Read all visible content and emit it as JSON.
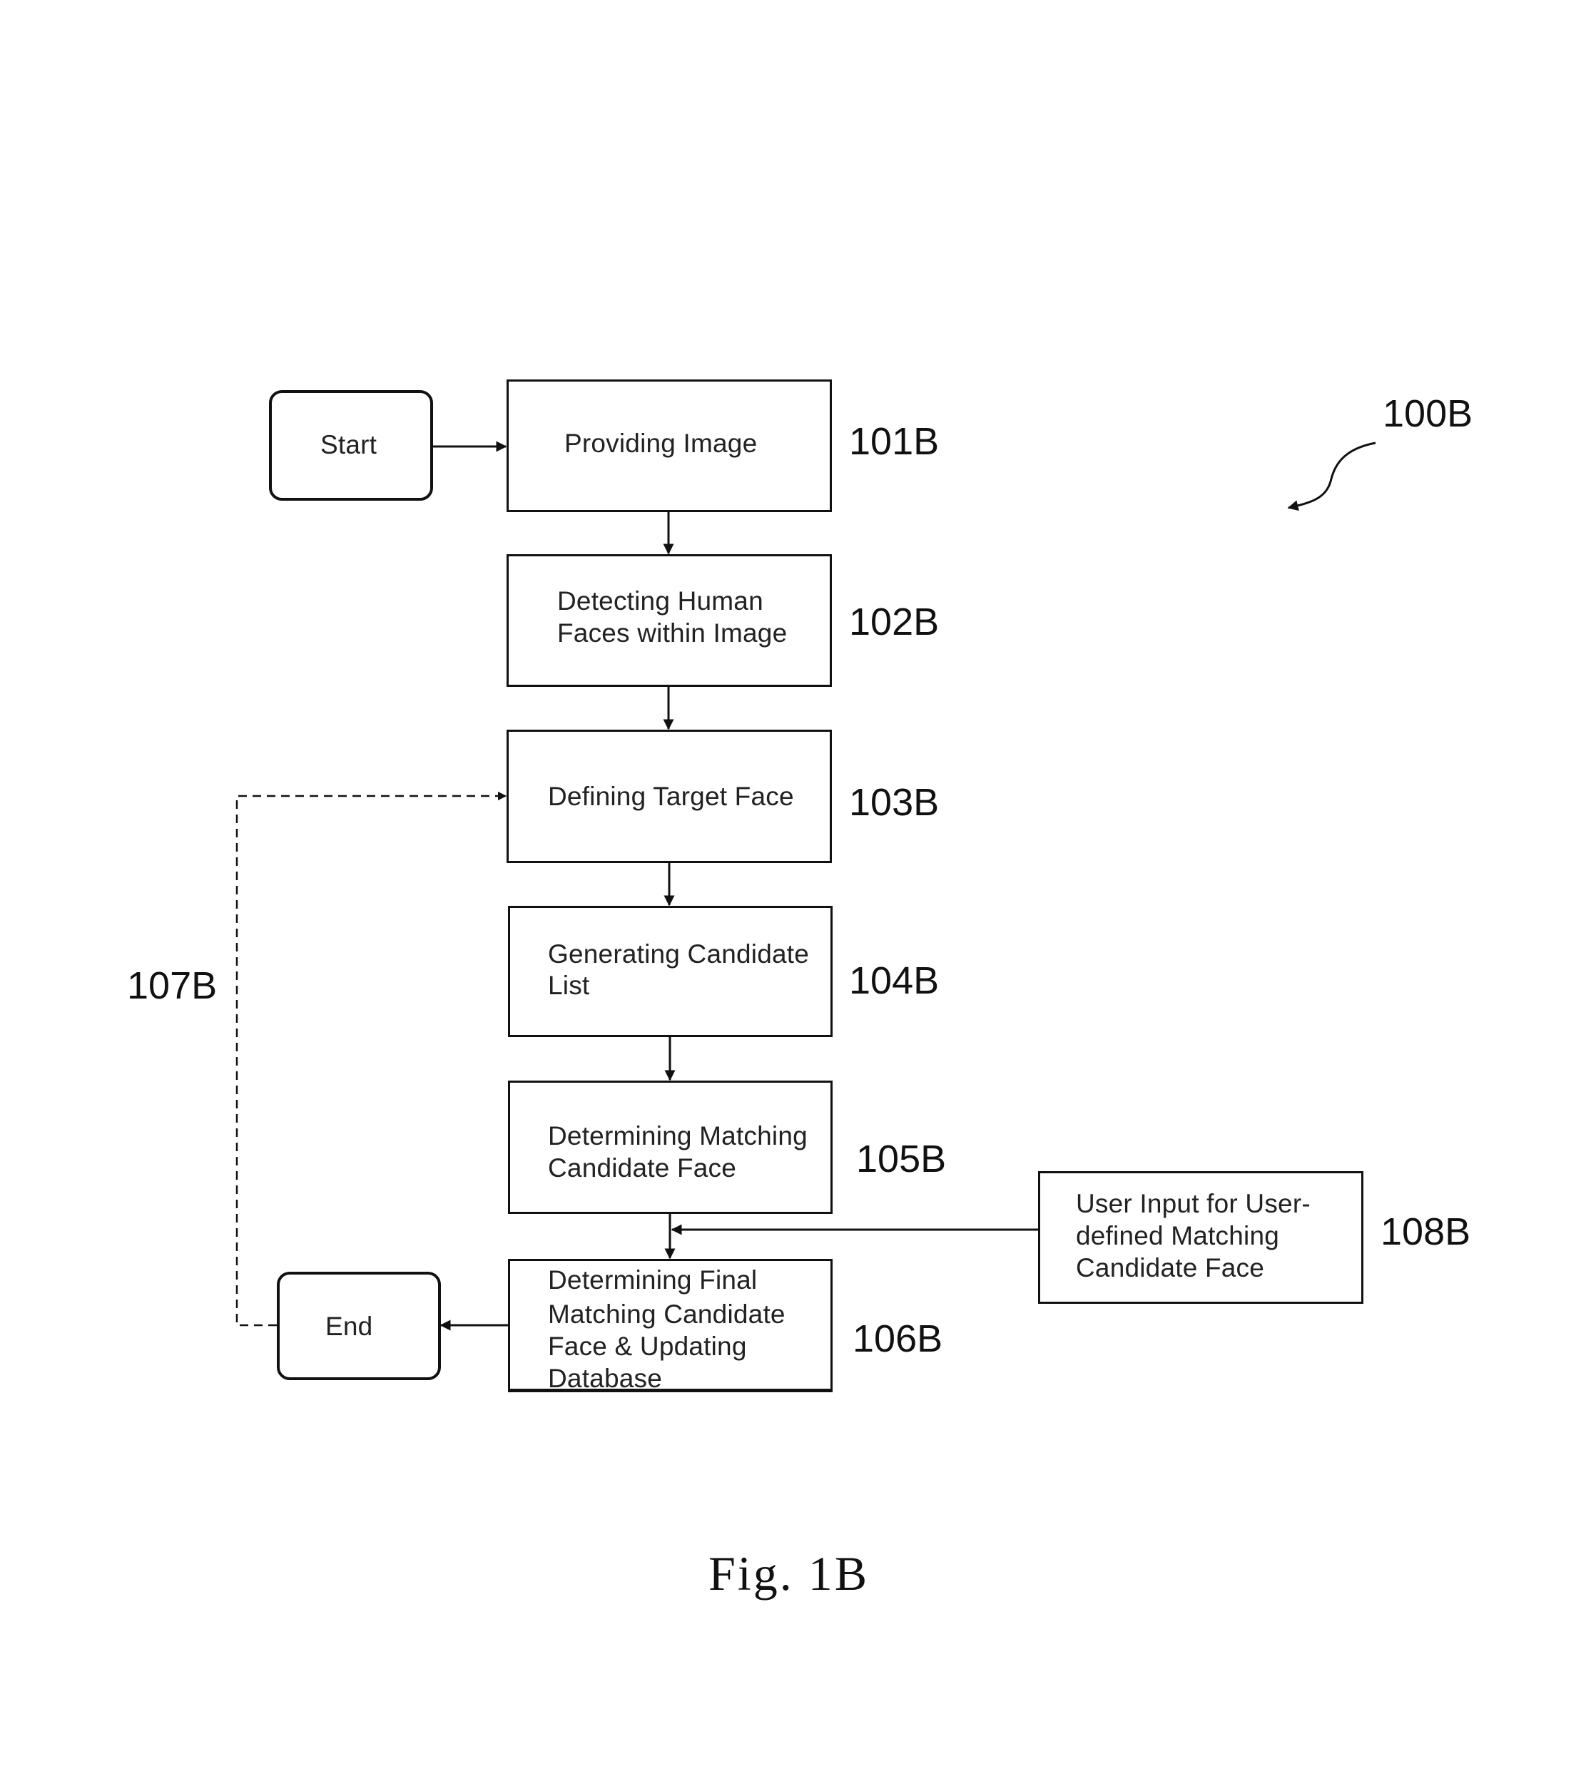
{
  "figure": {
    "id_label": "100B",
    "caption": "Fig. 1B"
  },
  "terminals": {
    "start": "Start",
    "end": "End"
  },
  "steps": [
    {
      "ref": "101B",
      "lines": [
        "Providing Image"
      ]
    },
    {
      "ref": "102B",
      "lines": [
        "Detecting Human",
        "Faces within Image"
      ]
    },
    {
      "ref": "103B",
      "lines": [
        "Defining Target Face"
      ]
    },
    {
      "ref": "104B",
      "lines": [
        "Generating Candidate",
        "List"
      ]
    },
    {
      "ref": "105B",
      "lines": [
        "Determining Matching",
        "Candidate Face"
      ]
    },
    {
      "ref": "106B",
      "lines": [
        "Determining Final",
        "Matching Candidate",
        "Face & Updating",
        "Database"
      ]
    }
  ],
  "user_input": {
    "ref": "108B",
    "lines": [
      "User Input for User-",
      "defined Matching",
      "Candidate Face"
    ]
  },
  "loop": {
    "ref": "107B",
    "style": "dashed",
    "from": "End",
    "to": "Defining Target Face"
  },
  "flow": [
    {
      "from": "Start",
      "to": "101B"
    },
    {
      "from": "101B",
      "to": "102B"
    },
    {
      "from": "102B",
      "to": "103B"
    },
    {
      "from": "103B",
      "to": "104B"
    },
    {
      "from": "104B",
      "to": "105B"
    },
    {
      "from": "105B",
      "to": "106B"
    },
    {
      "from": "108B",
      "to": "106B"
    },
    {
      "from": "106B",
      "to": "End"
    },
    {
      "from": "End",
      "to": "103B",
      "style": "dashed"
    }
  ]
}
